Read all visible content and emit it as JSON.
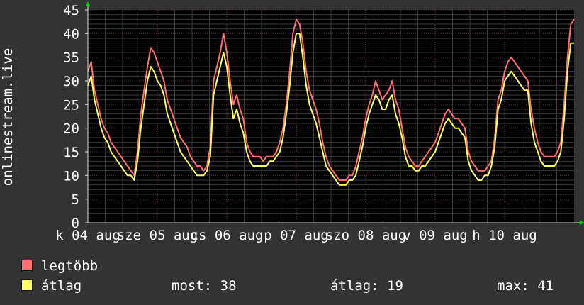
{
  "chart_data": {
    "type": "line",
    "ylabel": "onlinestream.live",
    "ylim": [
      0,
      45
    ],
    "yticks": [
      0,
      5,
      10,
      15,
      20,
      25,
      30,
      35,
      40,
      45
    ],
    "xticks": [
      "k 04 aug",
      "sze 05 aug",
      "cs 06 aug",
      "p 07 aug",
      "szo 08 aug",
      "v 09 aug",
      "h 10 aug"
    ],
    "grid": true,
    "colors": {
      "max": "#ff7070",
      "avg": "#ffff66"
    },
    "series": [
      {
        "name": "legtöbb",
        "values": [
          32,
          34,
          28,
          25,
          22,
          20,
          19,
          17,
          16,
          15,
          14,
          13,
          12,
          11,
          10,
          15,
          23,
          28,
          33,
          37,
          36,
          34,
          32,
          30,
          26,
          24,
          22,
          20,
          18,
          17,
          16,
          14,
          13,
          12,
          12,
          11,
          12,
          16,
          30,
          33,
          36,
          40,
          36,
          30,
          25,
          27,
          24,
          22,
          17,
          15,
          14,
          14,
          14,
          13,
          14,
          14,
          14,
          15,
          17,
          20,
          25,
          32,
          40,
          43,
          42,
          38,
          32,
          28,
          26,
          24,
          21,
          17,
          14,
          12,
          11,
          10,
          9,
          9,
          9,
          10,
          10,
          12,
          15,
          18,
          22,
          25,
          27,
          30,
          28,
          26,
          27,
          28,
          30,
          26,
          24,
          20,
          16,
          14,
          13,
          12,
          12,
          13,
          14,
          15,
          16,
          17,
          19,
          21,
          23,
          24,
          23,
          22,
          22,
          21,
          20,
          15,
          13,
          12,
          11,
          11,
          11,
          12,
          13,
          18,
          26,
          28,
          32,
          34,
          35,
          34,
          33,
          32,
          31,
          30,
          24,
          20,
          17,
          15,
          14,
          14,
          14,
          14,
          15,
          17,
          25,
          35,
          42,
          43
        ]
      },
      {
        "name": "átlag",
        "values": [
          29,
          31,
          26,
          23,
          20,
          18,
          17,
          15,
          14,
          13,
          12,
          11,
          10,
          10,
          9,
          13,
          20,
          25,
          30,
          33,
          32,
          30,
          29,
          27,
          23,
          21,
          19,
          17,
          15,
          14,
          13,
          12,
          11,
          10,
          10,
          10,
          11,
          14,
          27,
          30,
          33,
          36,
          33,
          27,
          22,
          24,
          21,
          19,
          15,
          13,
          12,
          12,
          12,
          12,
          12,
          13,
          13,
          14,
          15,
          18,
          23,
          29,
          36,
          40,
          40,
          35,
          29,
          25,
          23,
          21,
          18,
          15,
          12,
          11,
          10,
          9,
          8,
          8,
          8,
          9,
          9,
          10,
          13,
          16,
          20,
          23,
          25,
          27,
          26,
          24,
          24,
          26,
          27,
          23,
          21,
          18,
          14,
          12,
          12,
          11,
          11,
          12,
          12,
          13,
          14,
          15,
          17,
          19,
          21,
          22,
          21,
          20,
          20,
          19,
          18,
          13,
          11,
          10,
          9,
          9,
          10,
          10,
          12,
          16,
          24,
          26,
          30,
          31,
          32,
          31,
          30,
          29,
          28,
          28,
          21,
          17,
          15,
          13,
          12,
          12,
          12,
          12,
          13,
          15,
          22,
          32,
          38,
          38
        ]
      }
    ]
  },
  "legend": [
    {
      "label": "legtöbb",
      "color": "#ff7070"
    },
    {
      "label": "átlag",
      "color": "#ffff66"
    }
  ],
  "stats": {
    "now_label": "most:",
    "now_value": "38",
    "avg_label": "átlag:",
    "avg_value": "19",
    "max_label": "max:",
    "max_value": "41"
  }
}
